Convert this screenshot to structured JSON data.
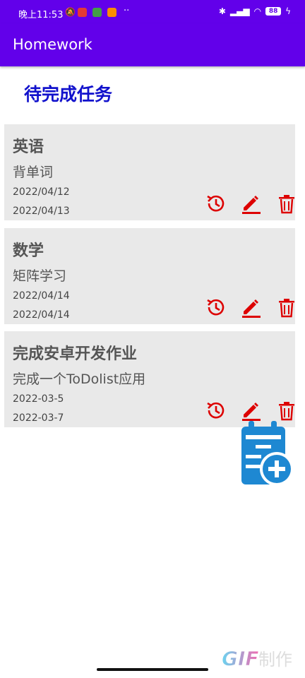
{
  "status_bar": {
    "time": "晚上11:53",
    "battery": "88",
    "icons": [
      "muted-bell-icon",
      "app-icon-red",
      "app-icon-green",
      "app-icon-orange",
      "bluetooth-icon",
      "cellular-signal-icon",
      "wifi-icon",
      "battery-icon",
      "charging-icon"
    ],
    "overflow": "··"
  },
  "app_bar": {
    "title": "Homework",
    "color": "#6200ea"
  },
  "section": {
    "title": "待完成任务",
    "color": "#1111cc"
  },
  "tasks": [
    {
      "category": "英语",
      "description": "背单词",
      "start_date": "2022/04/12",
      "due_date": "2022/04/13"
    },
    {
      "category": "数学",
      "description": "矩阵学习",
      "start_date": "2022/04/14",
      "due_date": "2022/04/14"
    },
    {
      "category": "完成安卓开发作业",
      "description": "完成一个ToDolist应用",
      "start_date": "2022-03-5",
      "due_date": "2022-03-7"
    }
  ],
  "actions": {
    "icons": [
      "history-icon",
      "edit-icon",
      "delete-icon"
    ],
    "color": "#dd0000"
  },
  "fab": {
    "icon": "calendar-add-icon",
    "color": "#1e88d2"
  },
  "watermark": {
    "text": "GIF制作"
  }
}
